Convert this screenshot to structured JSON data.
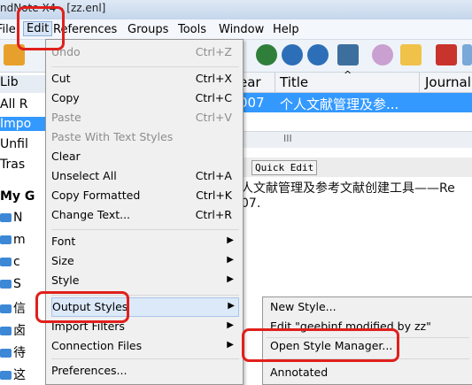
{
  "window": {
    "title_fragment": "ndNote X4 - [zz.enl]"
  },
  "menubar": [
    {
      "label": "File"
    },
    {
      "label": "Edit"
    },
    {
      "label": "References"
    },
    {
      "label": "Groups"
    },
    {
      "label": "Tools"
    },
    {
      "label": "Window"
    },
    {
      "label": "Help"
    }
  ],
  "library_panel": {
    "header": "Lib",
    "rows": [
      "All R",
      "Impo",
      "Unfil",
      "Tras",
      "My G"
    ],
    "groups": [
      "N",
      "m",
      "c",
      "S",
      "信",
      "卤",
      "待",
      "这"
    ]
  },
  "reference_list": {
    "columns": [
      "ear",
      "Title",
      "Journal"
    ],
    "selected_row": {
      "year": "007",
      "title": "个人文献管理及参..."
    },
    "scroll_marker": "III",
    "sort_indicator": "^"
  },
  "preview_tabs": {
    "quick_edit": "Quick Edit"
  },
  "preview_text": {
    "line1": "人文献管理及参考文献创建工具——Re",
    "line2": "07."
  },
  "edit_menu": {
    "undo": {
      "label": "Undo",
      "shortcut": "Ctrl+Z"
    },
    "cut": {
      "label": "Cut",
      "shortcut": "Ctrl+X"
    },
    "copy": {
      "label": "Copy",
      "shortcut": "Ctrl+C"
    },
    "paste": {
      "label": "Paste",
      "shortcut": "Ctrl+V"
    },
    "paste_with_styles": {
      "label": "Paste With Text Styles"
    },
    "clear": {
      "label": "Clear"
    },
    "unselect_all": {
      "label": "Unselect All",
      "shortcut": "Ctrl+A"
    },
    "copy_formatted": {
      "label": "Copy Formatted",
      "shortcut": "Ctrl+K"
    },
    "change_text": {
      "label": "Change Text...",
      "shortcut": "Ctrl+R"
    },
    "font": {
      "label": "Font"
    },
    "size": {
      "label": "Size"
    },
    "style": {
      "label": "Style"
    },
    "output_styles": {
      "label": "Output Styles"
    },
    "import_filters": {
      "label": "Import Filters"
    },
    "connection_files": {
      "label": "Connection Files"
    },
    "preferences": {
      "label": "Preferences..."
    },
    "arrow": "▶"
  },
  "output_styles_submenu": {
    "new_style": "New Style...",
    "edit_style": "Edit \"geebinf modified by zz\"",
    "open_manager": "Open Style Manager...",
    "annotated": "Annotated"
  },
  "colors": {
    "selection": "#3399ff",
    "annotation_red": "#e0201c",
    "menu_bg": "#f0f0f0"
  }
}
